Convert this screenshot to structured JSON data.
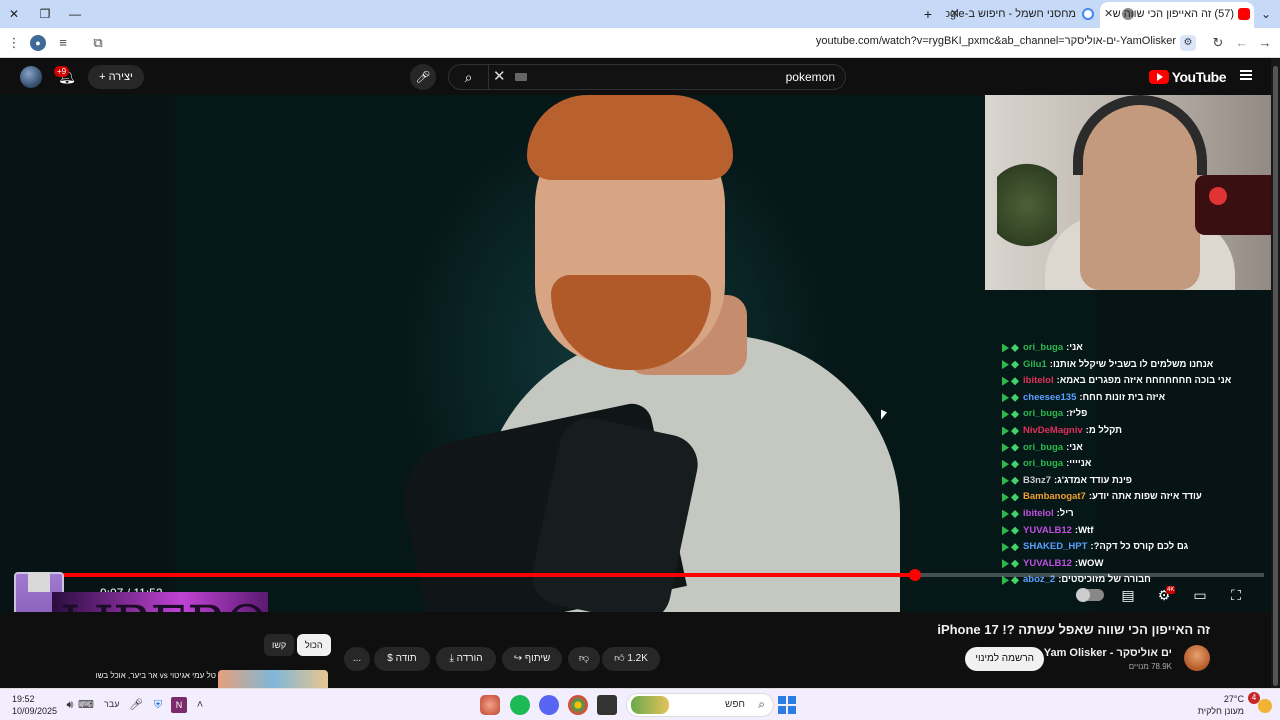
{
  "browser": {
    "tabs": [
      {
        "title": "(57) זה האייפון הכי שווה ש",
        "active": true
      },
      {
        "title": "מחסני חשמל - חיפוש ב-Google",
        "active": false
      }
    ],
    "new_tab_label": "+",
    "url": "youtube.com/watch?v=rygBKI_pxmc&ab_channel=ים-אוליסקר-YamOlisker"
  },
  "youtube": {
    "logo_text": "YouTube",
    "search_query": "pokemon",
    "create_label": "יצירה",
    "notification_count": "+9"
  },
  "player": {
    "time_current": "9:07",
    "time_total": "11:52",
    "progress_fraction": 0.72,
    "hd_badge": "4K",
    "chat": [
      {
        "user": "ori_buga",
        "user_color": "#2db84e",
        "msg": "אני"
      },
      {
        "user": "Gilu1",
        "user_color": "#2db84e",
        "msg": "אנחנו משלמים לו בשביל שיקלל אותנו"
      },
      {
        "user": "ibitelol",
        "user_color": "#e0305a",
        "msg": "אני בוכה חחחחחחח איזה מפגרים באמא"
      },
      {
        "user": "cheesee135",
        "user_color": "#5aa0ff",
        "msg": "איזה בית זונות חחח"
      },
      {
        "user": "ori_buga",
        "user_color": "#2db84e",
        "msg": "פליז"
      },
      {
        "user": "NivDeMagniv",
        "user_color": "#e0305a",
        "msg": "תקלל מ"
      },
      {
        "user": "ori_buga",
        "user_color": "#2db84e",
        "msg": "אני"
      },
      {
        "user": "ori_buga",
        "user_color": "#2db84e",
        "msg": "אניייי"
      },
      {
        "user": "B3nz7",
        "user_color": "#cccccc",
        "msg": "פינת עודד אמדג'ג"
      },
      {
        "user": "Bambanogat7",
        "user_color": "#f0a030",
        "msg": "עודד איזה שפות אתה יודע"
      },
      {
        "user": "ibitelol",
        "user_color": "#c050e0",
        "msg": "ריל"
      },
      {
        "user": "YUVALB12",
        "user_color": "#c050e0",
        "msg": "Wtf"
      },
      {
        "user": "SHAKED_HPT",
        "user_color": "#5aa0ff",
        "msg": "גם לכם קורס כל דקה?"
      },
      {
        "user": "YUVALB12",
        "user_color": "#c050e0",
        "msg": "WOW"
      },
      {
        "user": "aboz_2",
        "user_color": "#5aa0ff",
        "msg": "חבורה של מזוכיסטים"
      }
    ],
    "overlay_logo_text": "LIBERO"
  },
  "video_info": {
    "title": "זה האייפון הכי שווה שאפל עשתה ?! iPhone 17",
    "channel_name": "ים אוליסקר - Yam Olisker",
    "subscribers": "78.9K מנויים",
    "subscribe_label": "הרשמה למינוי",
    "like_count": "1.2K",
    "share_label": "שיתוף",
    "download_label": "הורדה",
    "thanks_label": "תודה",
    "more_label": "...",
    "chip_all": "הכול",
    "chip_related": "קשו",
    "rec_title": "טל עמי אגיטוי vs אר ביער, אוכל בשו"
  },
  "taskbar": {
    "time": "19:52",
    "date": "10/09/2025",
    "language": "עבר",
    "search_placeholder": "חפש",
    "weather_temp": "27°C",
    "weather_desc": "מעונן חלקית",
    "notification_count": "4"
  }
}
